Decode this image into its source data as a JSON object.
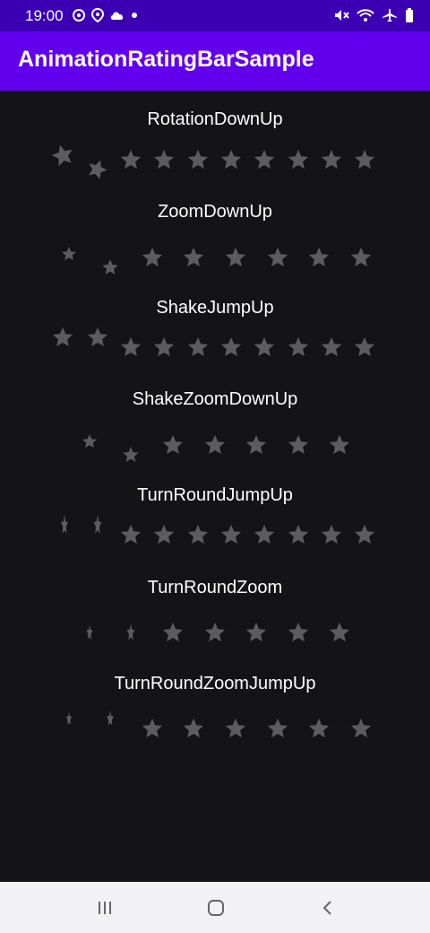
{
  "status_bar": {
    "time": "19:00",
    "left_icons": [
      "sync-icon",
      "location-icon",
      "cloud-icon",
      "notification-dot-icon"
    ],
    "right_icons": [
      "mute-icon",
      "wifi-icon",
      "airplane-icon",
      "battery-icon"
    ]
  },
  "app_bar": {
    "title": "AnimationRatingBarSample"
  },
  "colors": {
    "status_bar": "#3a00b2",
    "app_bar": "#6200ee",
    "background": "#141416",
    "star": "#5c5c5e",
    "nav_bar": "#f2f2f4"
  },
  "sections": [
    {
      "label": "RotationDownUp",
      "rating": 0,
      "max": 10
    },
    {
      "label": "ZoomDownUp",
      "rating": 0,
      "max": 8
    },
    {
      "label": "ShakeJumpUp",
      "rating": 0,
      "max": 10
    },
    {
      "label": "ShakeZoomDownUp",
      "rating": 0,
      "max": 7
    },
    {
      "label": "TurnRoundJumpUp",
      "rating": 0,
      "max": 10
    },
    {
      "label": "TurnRoundZoom",
      "rating": 0,
      "max": 7
    },
    {
      "label": "TurnRoundZoomJumpUp",
      "rating": 0,
      "max": 8
    }
  ],
  "nav_bar": {
    "icons": [
      "recent-apps-icon",
      "home-icon",
      "back-icon"
    ]
  }
}
